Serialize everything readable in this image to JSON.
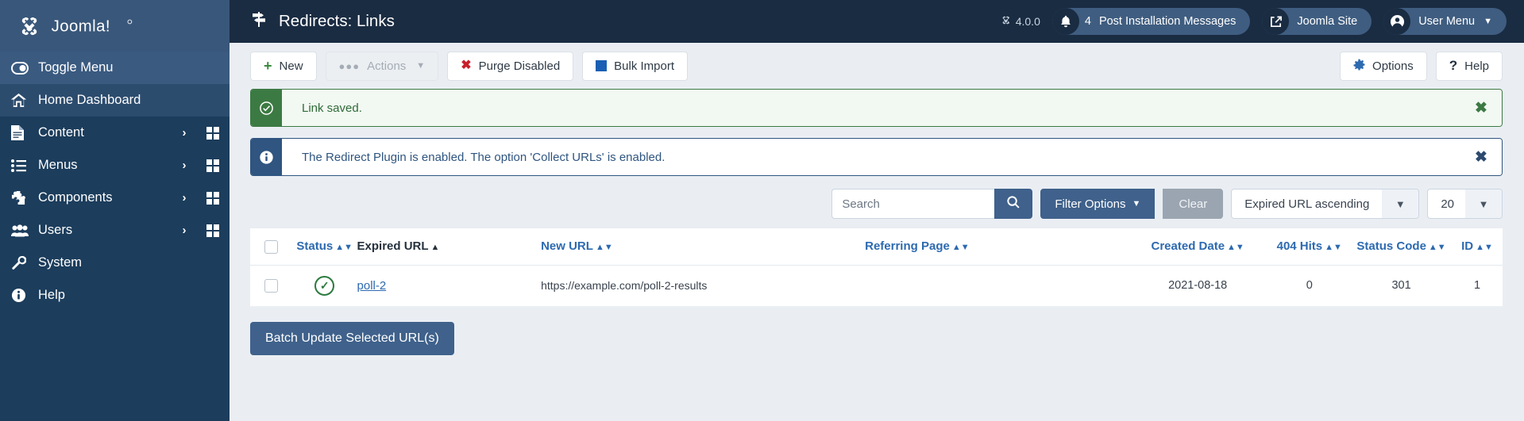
{
  "brand": {
    "name": "Joomla!",
    "logo_icon": "joomla-logo-icon"
  },
  "sidebar": {
    "items": [
      {
        "label": "Toggle Menu",
        "icon": "toggle-icon",
        "state": "toggle",
        "chevron": false,
        "grid": false
      },
      {
        "label": "Home Dashboard",
        "icon": "home-icon",
        "state": "dash",
        "chevron": false,
        "grid": false
      },
      {
        "label": "Content",
        "icon": "document-icon",
        "state": "",
        "chevron": true,
        "grid": true
      },
      {
        "label": "Menus",
        "icon": "list-icon",
        "state": "",
        "chevron": true,
        "grid": true
      },
      {
        "label": "Components",
        "icon": "puzzle-icon",
        "state": "",
        "chevron": true,
        "grid": true
      },
      {
        "label": "Users",
        "icon": "users-icon",
        "state": "",
        "chevron": true,
        "grid": true
      },
      {
        "label": "System",
        "icon": "wrench-icon",
        "state": "",
        "chevron": false,
        "grid": false
      },
      {
        "label": "Help",
        "icon": "info-circle-icon",
        "state": "",
        "chevron": false,
        "grid": false
      }
    ]
  },
  "header": {
    "title": "Redirects: Links",
    "title_icon": "signpost-icon",
    "version": "4.0.0",
    "version_icon": "joomla-mark-icon",
    "notifications": {
      "count": "4",
      "label": "Post Installation Messages",
      "icon": "bell-icon"
    },
    "site": {
      "label": "Joomla Site",
      "icon": "external-link-icon"
    },
    "user": {
      "label": "User Menu",
      "icon": "user-circle-icon",
      "caret": "chevron-down-icon"
    }
  },
  "toolbar": {
    "new_label": "New",
    "actions_label": "Actions",
    "purge_label": "Purge Disabled",
    "bulk_import_label": "Bulk Import",
    "options_label": "Options",
    "help_label": "Help"
  },
  "alerts": [
    {
      "type": "success",
      "icon": "check-circle-icon",
      "message": "Link saved.",
      "close": "✖"
    },
    {
      "type": "info",
      "icon": "info-icon",
      "message": "The Redirect Plugin is enabled. The option 'Collect URLs' is enabled.",
      "close": "✖"
    }
  ],
  "filters": {
    "search_placeholder": "Search",
    "search_value": "",
    "search_icon": "search-icon",
    "filter_options_label": "Filter Options",
    "clear_label": "Clear",
    "sort_value": "Expired URL ascending",
    "limit_value": "20"
  },
  "table": {
    "columns": [
      {
        "key": "checkbox",
        "label": "",
        "cls": "col-cb",
        "sortable": false,
        "active": false,
        "sort": ""
      },
      {
        "key": "status",
        "label": "Status",
        "cls": "col-status",
        "sortable": true,
        "active": false,
        "sort": "both"
      },
      {
        "key": "expired_url",
        "label": "Expired URL",
        "cls": "col-exp",
        "sortable": true,
        "active": true,
        "sort": "asc"
      },
      {
        "key": "new_url",
        "label": "New URL",
        "cls": "col-new",
        "sortable": true,
        "active": false,
        "sort": "both"
      },
      {
        "key": "referring_page",
        "label": "Referring Page",
        "cls": "col-ref",
        "sortable": true,
        "active": false,
        "sort": "both"
      },
      {
        "key": "created_date",
        "label": "Created Date",
        "cls": "col-date",
        "sortable": true,
        "active": false,
        "sort": "both"
      },
      {
        "key": "hits_404",
        "label": "404 Hits",
        "cls": "col-hits",
        "sortable": true,
        "active": false,
        "sort": "both"
      },
      {
        "key": "status_code",
        "label": "Status Code",
        "cls": "col-code",
        "sortable": true,
        "active": false,
        "sort": "both"
      },
      {
        "key": "id",
        "label": "ID",
        "cls": "col-id",
        "sortable": true,
        "active": false,
        "sort": "both"
      }
    ],
    "rows": [
      {
        "status": "enabled",
        "status_icon": "check-circle-icon",
        "expired_url": "poll-2",
        "new_url": "https://example.com/poll-2-results",
        "referring_page": "",
        "created_date": "2021-08-18",
        "hits_404": "0",
        "status_code": "301",
        "id": "1"
      }
    ]
  },
  "footer": {
    "batch_label": "Batch Update Selected URL(s)"
  },
  "colors": {
    "sidebar_bg": "#1c3d5c",
    "topbar_bg": "#1a2c42",
    "accent": "#3f618b",
    "link": "#2d6ab0",
    "success": "#3c7a43",
    "info": "#2f5580",
    "page_bg": "#eaeef3"
  }
}
